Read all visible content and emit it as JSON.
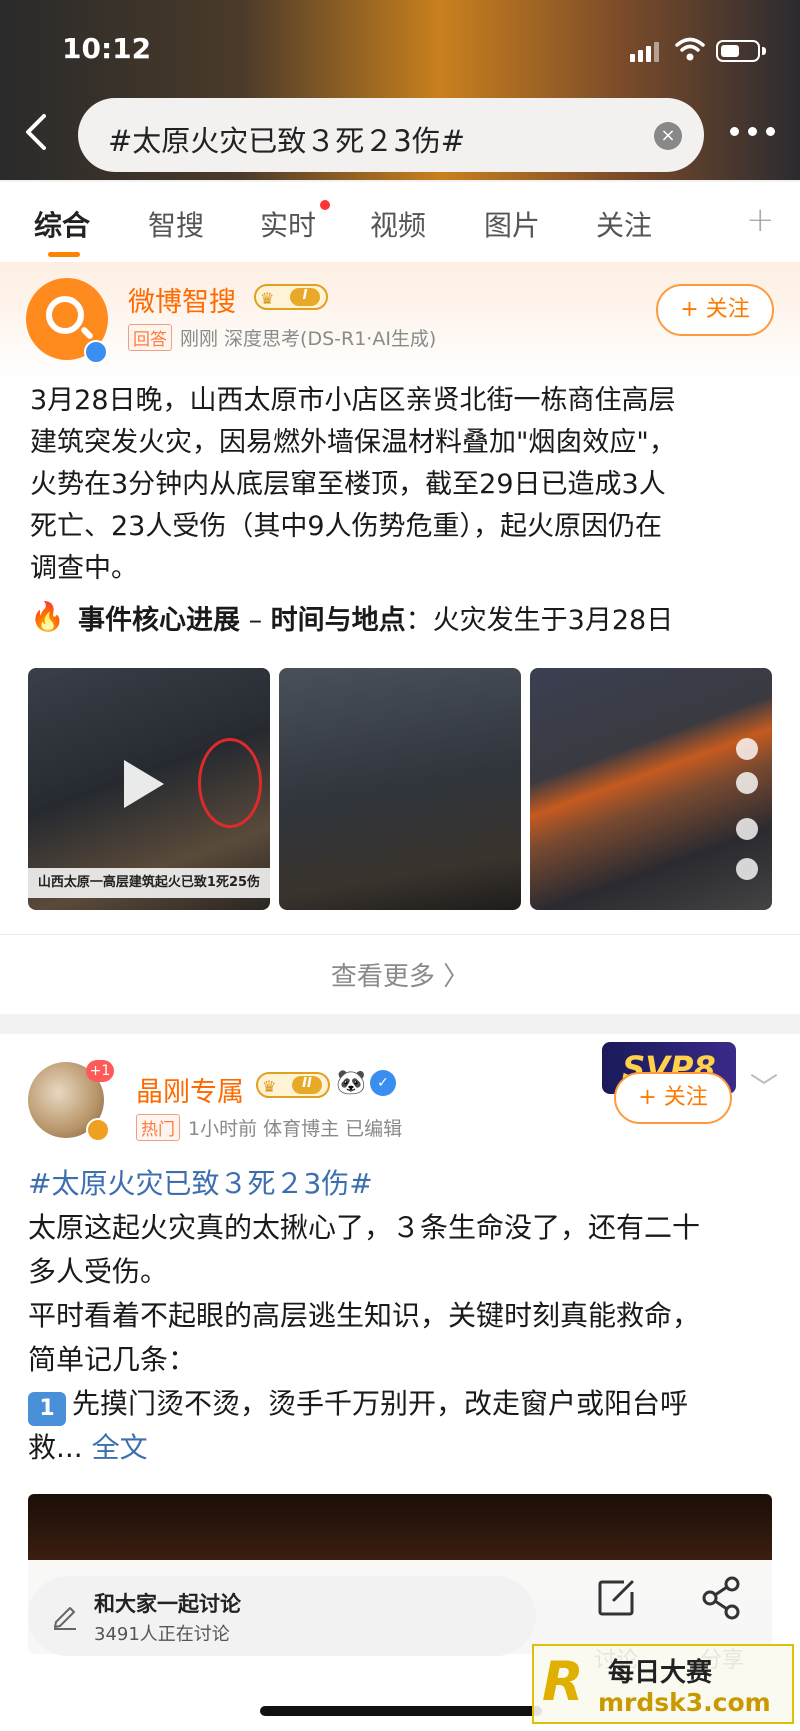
{
  "status_bar": {
    "time": "10:12"
  },
  "search": {
    "query": "#太原火灾已致３死２3伤#"
  },
  "tabs": [
    {
      "label": "综合",
      "active": true
    },
    {
      "label": "智搜"
    },
    {
      "label": "实时",
      "has_dot": true
    },
    {
      "label": "视频"
    },
    {
      "label": "图片"
    },
    {
      "label": "关注"
    }
  ],
  "card1": {
    "author": "微博智搜",
    "vip_level": "I",
    "tag": "回答",
    "meta": "刚刚  深度思考(DS-R1·AI生成)",
    "follow_label": "+ 关注",
    "paragraph_lines": [
      "3月28日晚，山西太原市小店区亲贤北街一栋商住高层",
      "建筑突发火灾，因易燃外墙保温材料叠加\"烟囱效应\"，",
      "火势在3分钟内从底层窜至楼顶，截至29日已造成3人",
      "死亡、23人受伤（其中9人伤势危重），起火原因仍在",
      "调查中。"
    ],
    "fire_emoji": "🔥",
    "core_title": "事件核心进展",
    "core_dash": " – ",
    "core_label": "时间与地点",
    "core_text": "：火灾发生于3月28日",
    "image_caption": "山西太原一高层建筑起火已致1死25伤",
    "see_more": "查看更多 〉"
  },
  "card2": {
    "badge": "+1",
    "author": "晶刚专属",
    "vip_level": "II",
    "panda": "🐼",
    "tag": "热门",
    "meta": "1小时前  体育博主  已编辑",
    "follow_label": "+ 关注",
    "svip": "SVP8",
    "hashtag": "#太原火灾已致３死２3伤#",
    "lines": [
      "太原这起火灾真的太揪心了，３条生命没了，还有二十",
      "多人受伤。",
      "平时看着不起眼的高层逃生知识，关键时刻真能救命，",
      "简单记几条："
    ],
    "item_num": "1",
    "item_line1": "先摸门烫不烫，烫手千万别开，改走窗户或阳台呼",
    "item_line2": "救...",
    "full_text": "全文"
  },
  "bottom": {
    "discuss_title": "和大家一起讨论",
    "discuss_sub": "3491人正在讨论",
    "comment_label": "讨论",
    "share_label": "分享"
  },
  "watermark": {
    "r": "R",
    "top": "每日大赛",
    "bottom": "mrdsk3.com"
  },
  "colors": {
    "accent": "#ff8200",
    "link": "#3d6fb0",
    "name": "#ff6a00"
  }
}
